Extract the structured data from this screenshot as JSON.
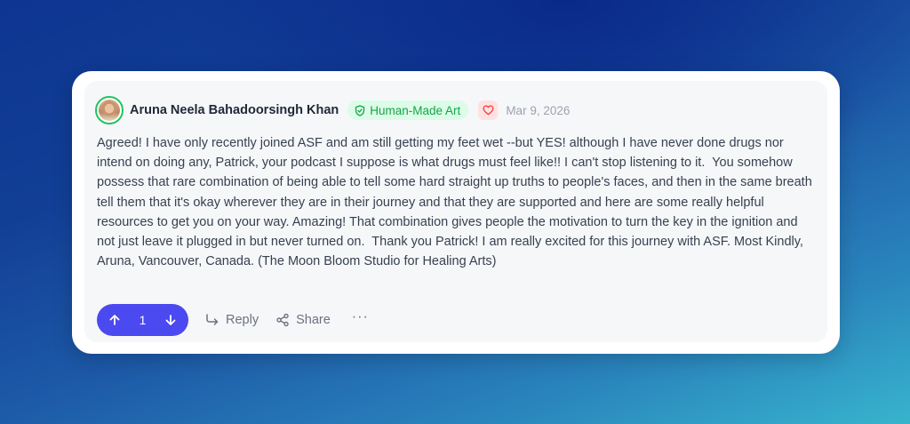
{
  "comment": {
    "author": "Aruna Neela Bahadoorsingh Khan",
    "badge": "Human-Made Art",
    "date": "Mar 9, 2026",
    "body": "Agreed! I have only recently joined ASF and am still getting my feet wet --but YES! although I have never done drugs nor intend on doing any, Patrick, your podcast I suppose is what drugs must feel like!! I can't stop listening to it.  You somehow possess that rare combination of being able to tell some hard straight up truths to people's faces, and then in the same breath tell them that it's okay wherever they are in their journey and that they are supported and here are some really helpful resources to get you on your way. Amazing! That combination gives people the motivation to turn the key in the ignition and not just leave it plugged in but never turned on.  Thank you Patrick! I am really excited for this journey with ASF. Most Kindly, Aruna, Vancouver, Canada. (The Moon Bloom Studio for Healing Arts)",
    "vote_count": "1",
    "reply_label": "Reply",
    "share_label": "Share",
    "more_label": "···"
  },
  "colors": {
    "accent": "#4b49f0",
    "badge_bg": "#dcfce7",
    "badge_text": "#16a34a",
    "heart_bg": "#fee2e2",
    "heart": "#ef4444",
    "avatar_ring": "#22c55e"
  },
  "icons": {
    "badge": "shield-check-icon",
    "reaction": "heart-icon",
    "upvote": "arrow-up-icon",
    "downvote": "arrow-down-icon",
    "reply": "reply-arrow-icon",
    "share": "share-icon",
    "more": "more-horizontal-icon"
  }
}
